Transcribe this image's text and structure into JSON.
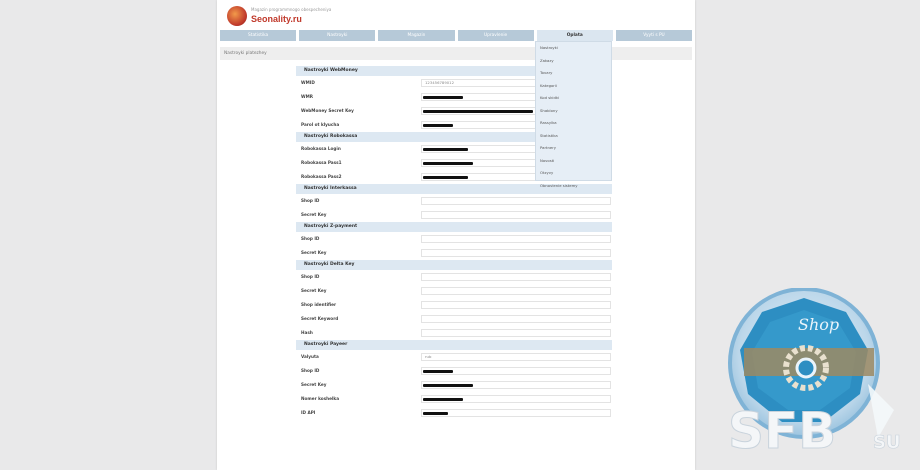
{
  "header": {
    "logo_tagline": "Magazin programmnogo obespecheniya",
    "logo_text": "Seonality.ru"
  },
  "nav": {
    "tabs": [
      {
        "label": "Statistika",
        "active": false
      },
      {
        "label": "Nastroyki",
        "active": false
      },
      {
        "label": "Magazin",
        "active": false
      },
      {
        "label": "Upravlenie",
        "active": false
      },
      {
        "label": "Oplata",
        "active": true
      },
      {
        "label": "Vyyti s PU",
        "active": false
      }
    ]
  },
  "subbar": {
    "text": "Nastroyki platezhey"
  },
  "dropdown": {
    "items": [
      "Nastroyki",
      "Zakazy",
      "Tovary",
      "Kategorii",
      "Kod skidki",
      "Shablony",
      "Rassylka",
      "Statistika",
      "Partnery",
      "Novosti",
      "Otzyvy",
      "Obnovlenie sistemy"
    ]
  },
  "form": {
    "sections": [
      {
        "title": "Nastroyki WebMoney",
        "rows": [
          {
            "label": "WMID",
            "value": "123456789012",
            "mask": 0
          },
          {
            "label": "WMR",
            "value": "",
            "mask": 40
          },
          {
            "label": "WebMoney Secret Key",
            "value": "",
            "mask": 110
          },
          {
            "label": "Parol ot klyucha",
            "value": "",
            "mask": 30
          }
        ]
      },
      {
        "title": "Nastroyki Robokassa",
        "rows": [
          {
            "label": "Robokassa Login",
            "value": "",
            "mask": 45
          },
          {
            "label": "Robokassa Pass1",
            "value": "",
            "mask": 50
          },
          {
            "label": "Robokassa Pass2",
            "value": "",
            "mask": 45
          }
        ]
      },
      {
        "title": "Nastroyki Interkassa",
        "rows": [
          {
            "label": "Shop ID",
            "value": "",
            "mask": 0
          },
          {
            "label": "Secret Key",
            "value": "",
            "mask": 0
          }
        ]
      },
      {
        "title": "Nastroyki Z-payment",
        "rows": [
          {
            "label": "Shop ID",
            "value": "",
            "mask": 0
          },
          {
            "label": "Secret Key",
            "value": "",
            "mask": 0
          }
        ]
      },
      {
        "title": "Nastroyki Delta Key",
        "rows": [
          {
            "label": "Shop ID",
            "value": "",
            "mask": 0
          },
          {
            "label": "Secret Key",
            "value": "",
            "mask": 0
          },
          {
            "label": "Shop identifier",
            "value": "",
            "mask": 0
          },
          {
            "label": "Secret Keyword",
            "value": "",
            "mask": 0
          },
          {
            "label": "Hash",
            "value": "",
            "mask": 0
          }
        ]
      },
      {
        "title": "Nastroyki Payeer",
        "rows": [
          {
            "label": "Valyuta",
            "value": "rub",
            "mask": 0
          },
          {
            "label": "Shop ID",
            "value": "",
            "mask": 30
          },
          {
            "label": "Secret Key",
            "value": "",
            "mask": 50
          },
          {
            "label": "Nomer koshelka",
            "value": "",
            "mask": 40
          },
          {
            "label": "ID API",
            "value": "",
            "mask": 25
          }
        ]
      }
    ]
  },
  "watermark": {
    "brand": "SFB",
    "tld": "SU",
    "badge_text": "Shop"
  },
  "colors": {
    "nav_tab": "#b6c9d8",
    "section_header": "#dde8f2",
    "logo_red": "#c0392b",
    "badge_blue": "#2d8ec2"
  }
}
